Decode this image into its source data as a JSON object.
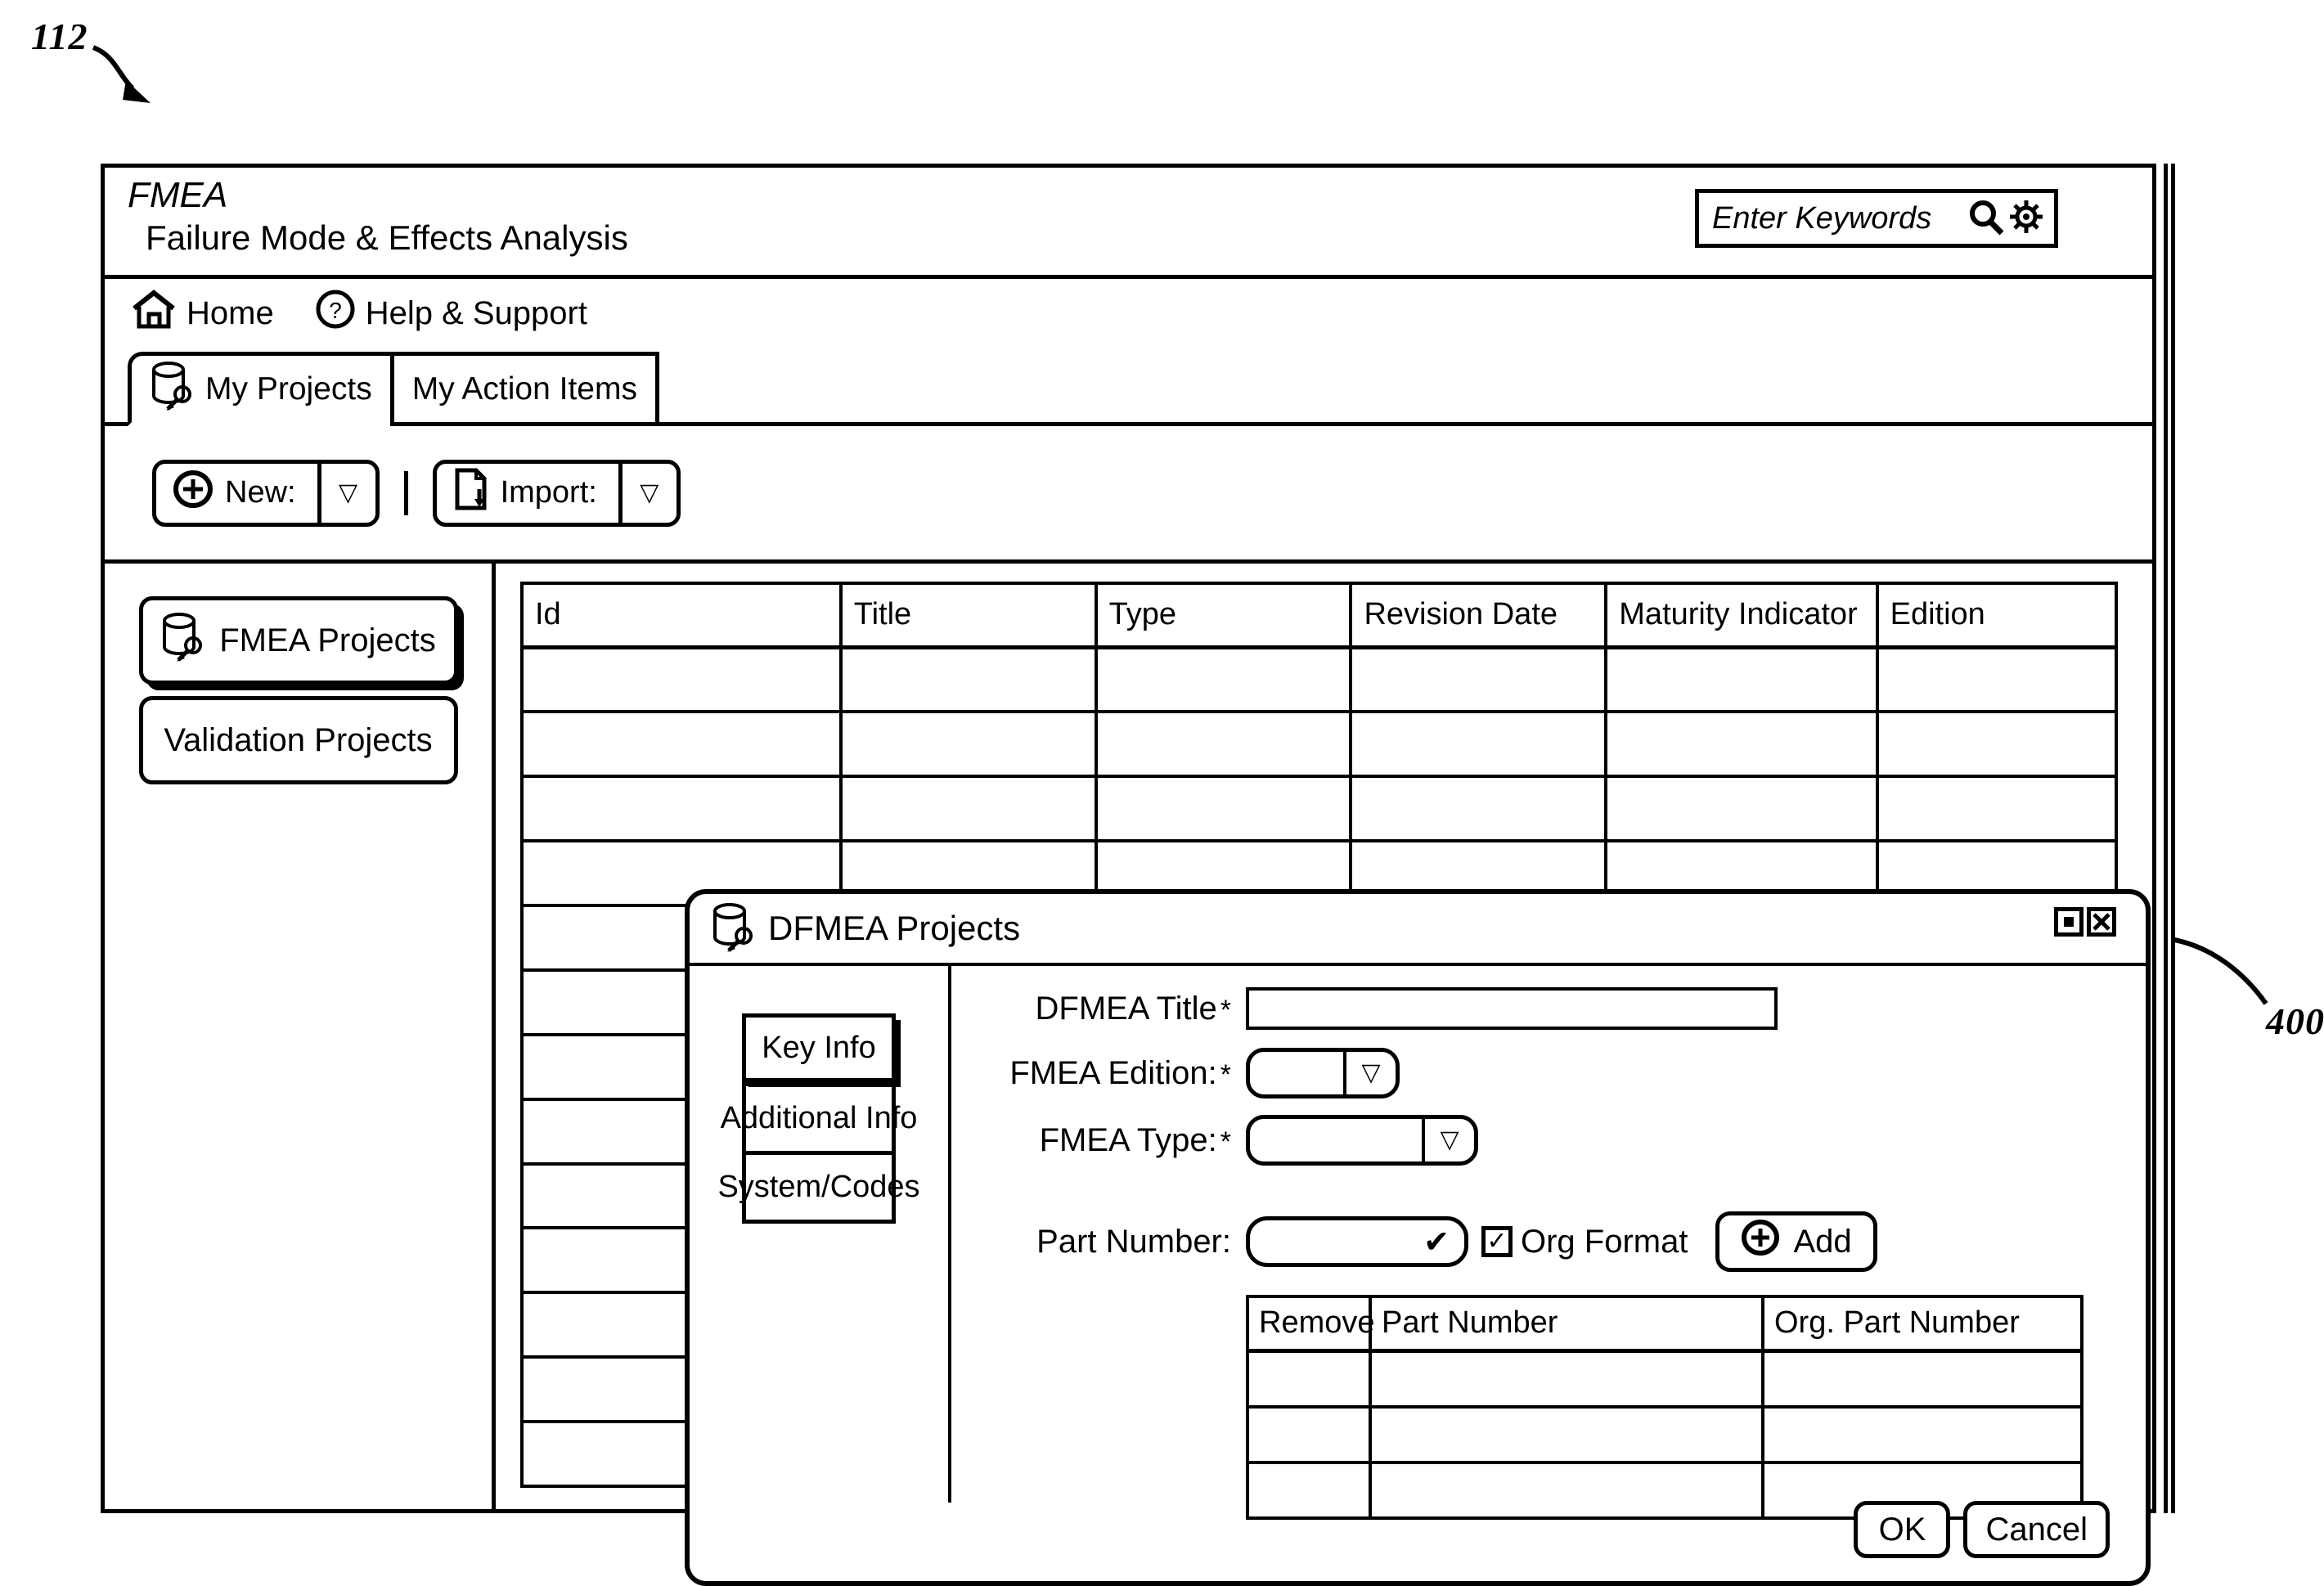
{
  "figure": {
    "ref_top": "112",
    "ref_right": "400"
  },
  "header": {
    "brand_abbr": "FMEA",
    "brand_full": "Failure Mode & Effects Analysis",
    "search": {
      "placeholder": "Enter Keywords",
      "search_icon": "magnifier-icon",
      "settings_icon": "gear-icon"
    }
  },
  "nav": {
    "items": [
      {
        "label": "Home",
        "icon": "home-icon"
      },
      {
        "label": "Help & Support",
        "icon": "question-circle-icon"
      }
    ]
  },
  "tabs": [
    {
      "label": "My Projects",
      "icon": "database-search-icon",
      "active": true
    },
    {
      "label": "My Action Items",
      "icon": "",
      "active": false
    }
  ],
  "toolbar": {
    "new_label": "New:",
    "new_icon": "plus-circle-icon",
    "new_caret": "chevron-down-icon",
    "import_label": "Import:",
    "import_icon": "document-import-icon",
    "import_caret": "chevron-down-icon"
  },
  "sidebar": {
    "items": [
      {
        "label": "FMEA Projects",
        "icon": "database-search-icon",
        "selected": true
      },
      {
        "label": "Validation Projects",
        "icon": "",
        "selected": false
      }
    ]
  },
  "projects_table": {
    "columns": [
      "Id",
      "Title",
      "Type",
      "Revision Date",
      "Maturity Indicator",
      "Edition"
    ],
    "row_count": 13,
    "rows": []
  },
  "dialog": {
    "title": "DFMEA Projects",
    "title_icon": "database-search-icon",
    "window_controls": [
      {
        "name": "maximize-icon",
        "glyph": "□"
      },
      {
        "name": "close-icon",
        "glyph": "✕"
      }
    ],
    "nav_items": [
      {
        "label": "Key Info",
        "active": true
      },
      {
        "label": "Additional Info",
        "active": false
      },
      {
        "label": "System/Codes",
        "active": false
      }
    ],
    "fields": {
      "title": {
        "label": "DFMEA Title",
        "required": "*",
        "value": ""
      },
      "edition": {
        "label": "FMEA Edition:",
        "required": "*",
        "value": "",
        "caret": "chevron-down-icon"
      },
      "type": {
        "label": "FMEA Type:",
        "required": "*",
        "value": "",
        "caret": "chevron-down-icon"
      },
      "part_number": {
        "label": "Part Number:",
        "value": "",
        "validate_icon": "check-icon"
      }
    },
    "org_format": {
      "label": "Org Format",
      "checked": true,
      "check_glyph": "✓"
    },
    "add_button": {
      "label": "Add",
      "icon": "plus-circle-icon"
    },
    "parts_table": {
      "columns": [
        "Remove",
        "Part Number",
        "Org. Part Number"
      ],
      "row_count": 3,
      "rows": []
    },
    "actions": [
      {
        "label": "OK",
        "name": "ok-button"
      },
      {
        "label": "Cancel",
        "name": "cancel-button"
      }
    ]
  }
}
